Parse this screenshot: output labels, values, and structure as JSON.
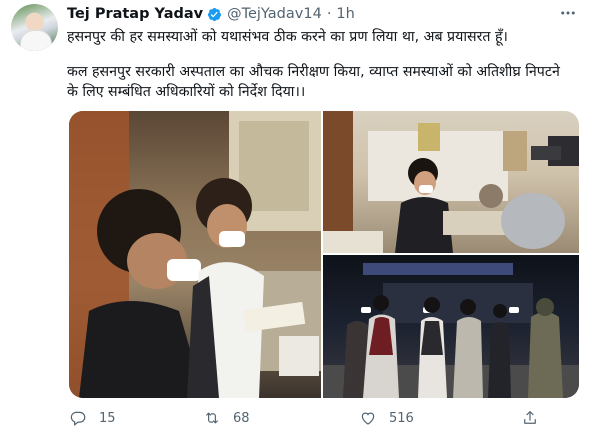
{
  "author": {
    "name": "Tej Pratap Yadav",
    "handle": "@TejYadav14",
    "separator": "·",
    "time": "1h",
    "verified": true
  },
  "tweet": {
    "line1": "हसनपुर की हर समस्याओं को यथासंभव ठीक करने का प्रण लिया था, अब प्रयासरत हूँ।",
    "line2": "कल हसनपुर सरकारी अस्पताल का औचक निरीक्षण किया, व्याप्त समस्याओं को अतिशीघ्र निपटने के लिए सम्बंधित अधिकारियों को निर्देश दिया।।"
  },
  "actions": {
    "reply_count": "15",
    "retweet_count": "68",
    "like_count": "516"
  },
  "icons": {
    "verified": "verified-badge-icon",
    "more": "more-horizontal-icon",
    "reply": "reply-icon",
    "retweet": "retweet-icon",
    "like": "heart-icon",
    "share": "share-icon"
  },
  "colors": {
    "verified": "#1d9bf0",
    "text": "#0f1419",
    "secondary": "#536471"
  }
}
